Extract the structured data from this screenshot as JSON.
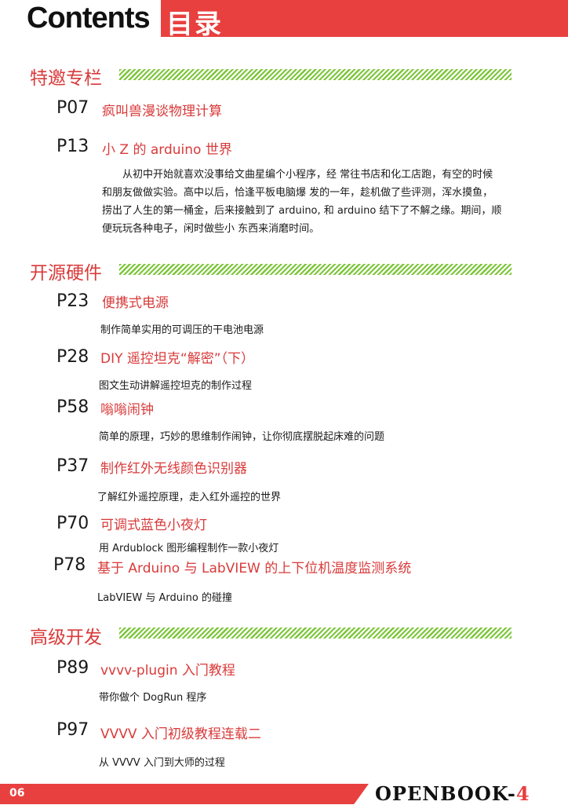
{
  "header": {
    "title_en": "Contents",
    "title_cn": "目录"
  },
  "sections": [
    {
      "title": "特邀专栏"
    },
    {
      "title": "开源硬件"
    },
    {
      "title": "高级开发"
    }
  ],
  "entries": [
    {
      "page": "P07",
      "title": "疯叫兽漫谈物理计算",
      "desc": ""
    },
    {
      "page": "P13",
      "title": "小 Z 的 arduino 世界",
      "desc": "从初中开始就喜欢没事给文曲星编个小程序，经 常往书店和化工店跑，有空的时候和朋友做做实验。高中以后，恰逢平板电脑爆 发的一年，趁机做了些评测，浑水摸鱼，捞出了人生的第一桶金，后来接触到了 arduino, 和 arduino 结下了不解之缘。期间，顺便玩玩各种电子，闲时做些小 东西来消磨时间。"
    },
    {
      "page": "P23",
      "title": "便携式电源",
      "desc": "制作简单实用的可调压的干电池电源"
    },
    {
      "page": "P28",
      "title": "DIY 遥控坦克“解密”（下）",
      "desc": "图文生动讲解遥控坦克的制作过程"
    },
    {
      "page": "P58",
      "title": "嗡嗡闹钟",
      "desc": "简单的原理，巧妙的思维制作闹钟，让你彻底摆脱起床难的问题"
    },
    {
      "page": "P37",
      "title": "制作红外无线颜色识别器",
      "desc": "了解红外遥控原理，走入红外遥控的世界"
    },
    {
      "page": "P70",
      "title": "可调式蓝色小夜灯",
      "desc": "用 Ardublock 图形编程制作一款小夜灯"
    },
    {
      "page": "P78",
      "title": "基于 Arduino 与 LabVIEW 的上下位机温度监测系统",
      "desc": "LabVIEW 与 Arduino 的碰撞"
    },
    {
      "page": "P89",
      "title": "vvvv-plugin 入门教程",
      "desc": "带你做个 DogRun 程序"
    },
    {
      "page": "P97",
      "title": "VVVV 入门初级教程连载二",
      "desc": "从 VVVV 入门到大师的过程"
    }
  ],
  "footer": {
    "page_number": "06",
    "brand_text": "OPENBOOK-",
    "brand_accent": "4"
  },
  "colors": {
    "accent_red": "#e8403f",
    "stripe_green": "#7cc63a"
  }
}
